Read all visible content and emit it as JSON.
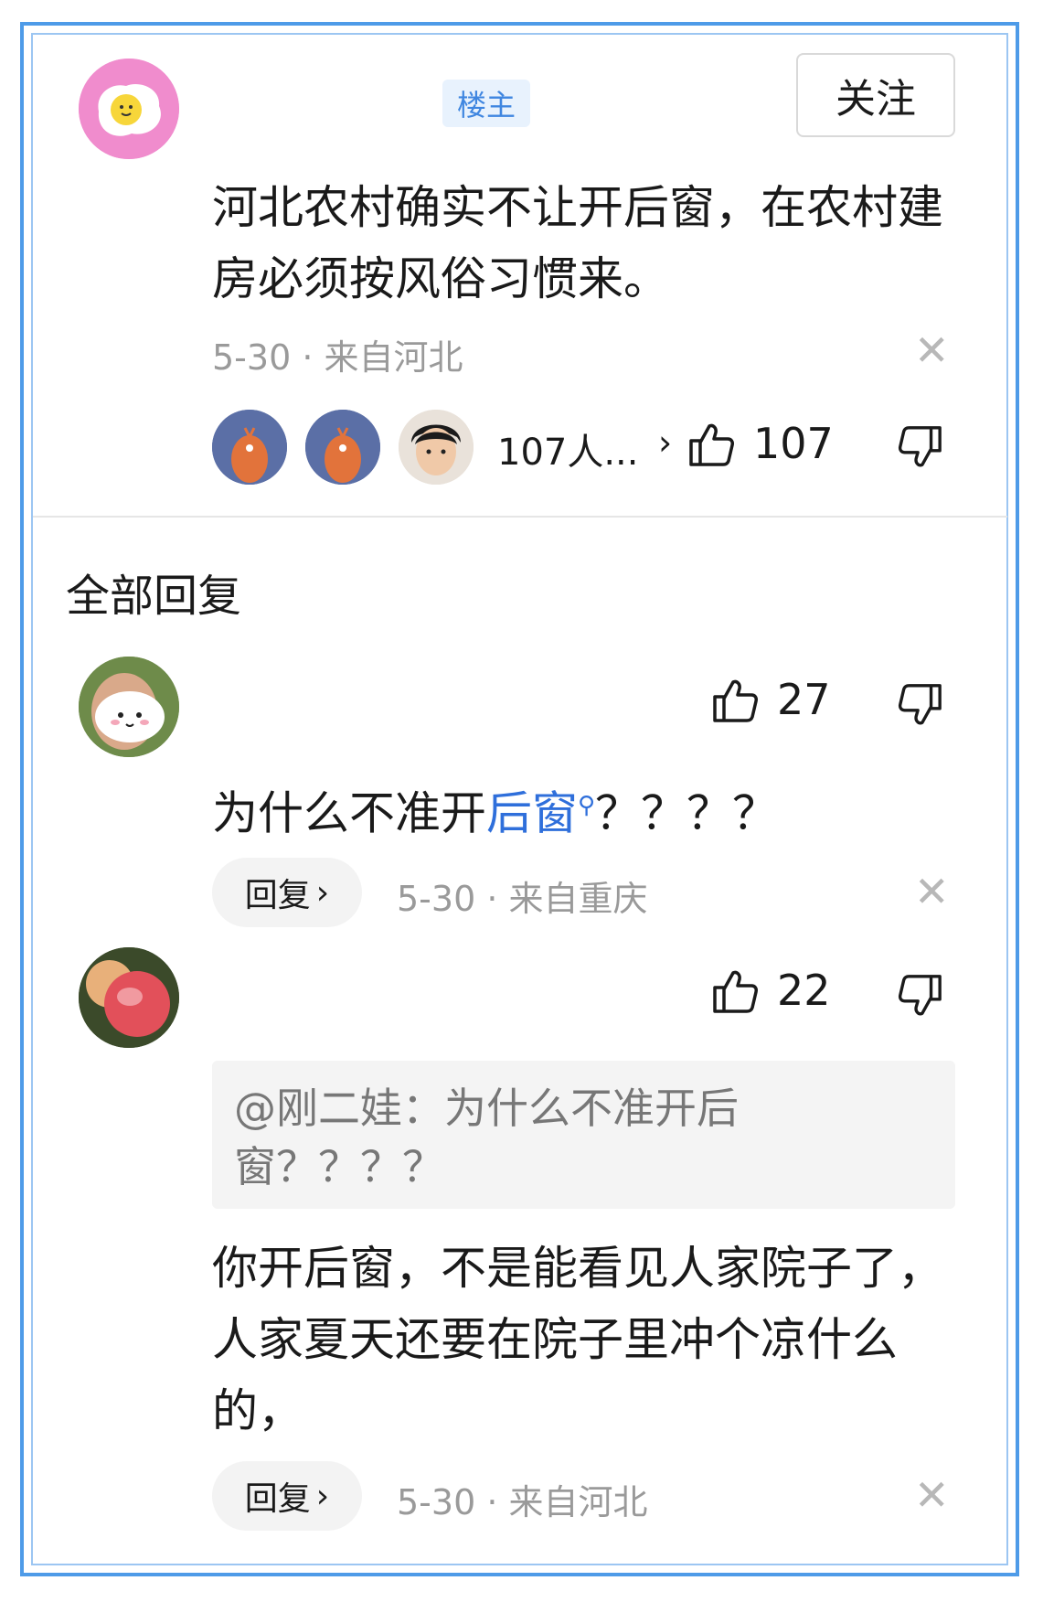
{
  "post": {
    "op_badge": "楼主",
    "follow_label": "关注",
    "content": "河北农村确实不让开后窗，在农村建房必须按风俗习惯来。",
    "meta": "5-30 · 来自河北",
    "liker_summary": "107人...",
    "like_count": "107",
    "icons": [
      "egg-avatar-icon",
      "close-icon",
      "chevron-right-icon",
      "thumbs-up-icon",
      "thumbs-down-icon"
    ]
  },
  "replies_header": "全部回复",
  "replies": [
    {
      "like_count": "27",
      "content_before_link": "为什么不准开",
      "content_link": "后窗",
      "content_after_link": "？？？？",
      "reply_label": "回复",
      "meta": "5-30 · 来自重庆"
    },
    {
      "like_count": "22",
      "quote": "@刚二娃：为什么不准开后窗？？？？",
      "content": "你开后窗，不是能看见人家院子了，人家夏天还要在院子里冲个凉什么的，",
      "reply_label": "回复",
      "meta": "5-30 · 来自河北"
    }
  ],
  "colors": {
    "frame_border": "#4e9be8",
    "link": "#2f6fdb",
    "badge_bg": "#e8f2fd",
    "badge_text": "#3f86e0"
  }
}
